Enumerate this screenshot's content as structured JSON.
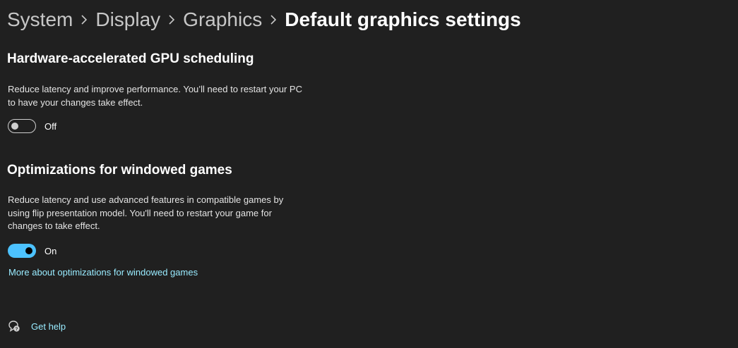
{
  "breadcrumb": {
    "items": [
      "System",
      "Display",
      "Graphics"
    ],
    "current": "Default graphics settings"
  },
  "gpu_scheduling": {
    "title": "Hardware-accelerated GPU scheduling",
    "description_line1": "Reduce latency and improve performance. You’ll need to restart your PC",
    "description_line2": "to have your changes take effect.",
    "toggle_state": "Off"
  },
  "windowed_games": {
    "title": "Optimizations for windowed games",
    "description_line1": "Reduce latency and use advanced features in compatible games by",
    "description_line2": "using flip presentation model. You'll need to restart your game for",
    "description_line3": "changes to take effect.",
    "toggle_state": "On",
    "link": "More about optimizations for windowed games"
  },
  "help": {
    "label": "Get help"
  },
  "colors": {
    "background": "#202020",
    "accent": "#4cc2ff",
    "link": "#99ebff"
  }
}
